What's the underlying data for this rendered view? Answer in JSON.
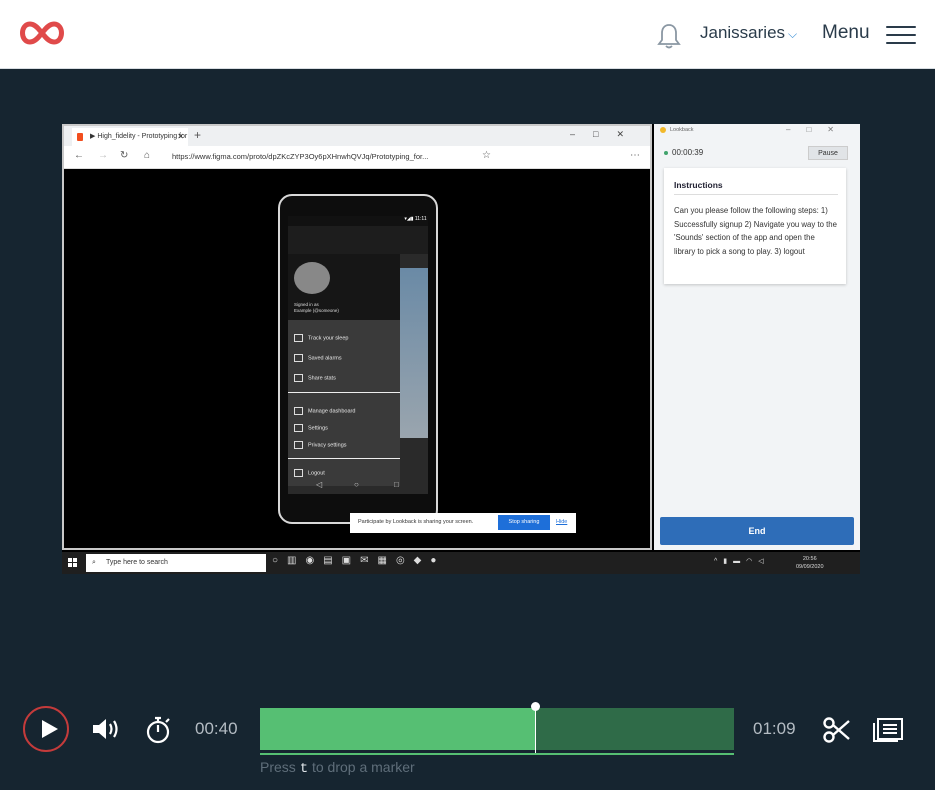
{
  "topbar": {
    "username": "Janissaries",
    "menu_label": "Menu",
    "accent": "#e04a4a"
  },
  "browser": {
    "tab_title": "▶ High_fidelity - Prototyping for",
    "url": "https://www.figma.com/proto/dpZKcZYP3Oy6pXHnwhQVJq/Prototyping_for..."
  },
  "phone": {
    "signed_in_label": "Signed in as",
    "username": "Example (@someone)",
    "drawer_items": [
      {
        "label": "Track your sleep"
      },
      {
        "label": "Saved alarms"
      },
      {
        "label": "Share stats"
      },
      {
        "label": "Manage dashboard"
      },
      {
        "label": "Settings"
      },
      {
        "label": "Privacy settings"
      },
      {
        "label": "Logout"
      }
    ]
  },
  "sharebar": {
    "text": "Participate by Lookback is sharing your screen.",
    "stop": "Stop sharing",
    "hide": "Hide"
  },
  "lookback": {
    "title": "Lookback",
    "timer": "00:00:39",
    "pause": "Pause",
    "instructions_title": "Instructions",
    "instructions_text": "Can you please follow the following steps: 1) Successfully signup 2) Navigate you way to the 'Sounds' section of the app and open the library to pick a song to play. 3) logout",
    "end": "End"
  },
  "taskbar": {
    "search_placeholder": "Type here to search",
    "clock_time": "20:56",
    "clock_date": "09/09/2020"
  },
  "player": {
    "current_time": "00:40",
    "total_time": "01:09",
    "progress": 0.58,
    "hint_pre": "Press",
    "hint_key": "t",
    "hint_post": "to drop a marker",
    "track_color": "#56bf73"
  }
}
